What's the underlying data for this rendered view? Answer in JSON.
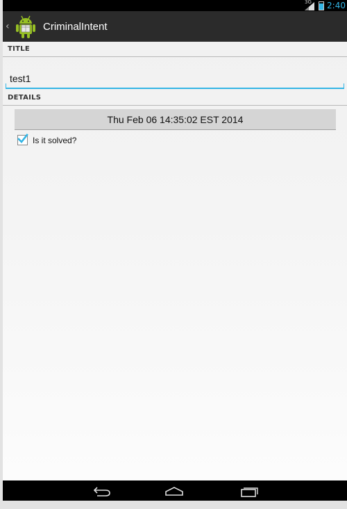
{
  "status_bar": {
    "network": "3G",
    "time": "2:40"
  },
  "action_bar": {
    "title": "CriminalIntent",
    "up_icon": "chevron-left-icon",
    "app_icon": "android-icon"
  },
  "sections": {
    "title_header": "TITLE",
    "details_header": "DETAILS"
  },
  "title_field": {
    "value": "test1"
  },
  "date_button": {
    "label": "Thu Feb 06 14:35:02 EST 2014"
  },
  "solved": {
    "label": "Is it solved?",
    "checked": true
  },
  "nav": {
    "back_icon": "back-icon",
    "home_icon": "home-icon",
    "recents_icon": "recents-icon"
  },
  "colors": {
    "accent": "#33b5e5",
    "action_bar": "#2b2b2b",
    "android_green": "#97c024"
  }
}
